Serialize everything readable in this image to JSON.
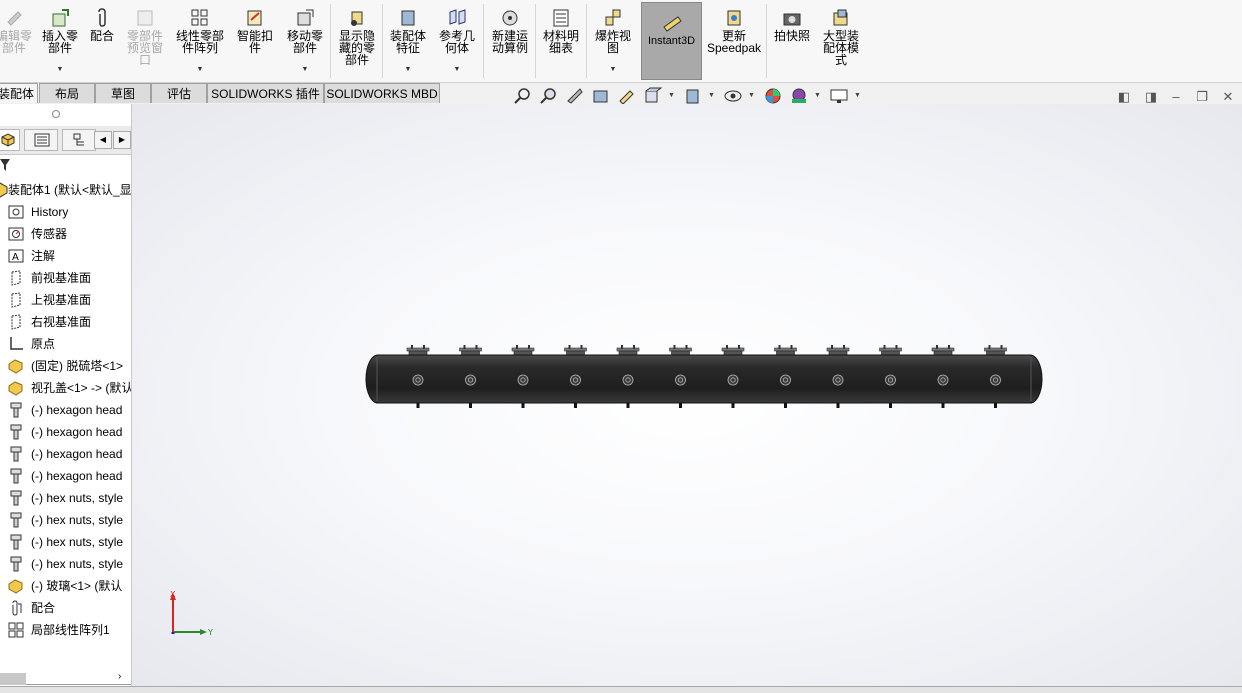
{
  "ribbon": {
    "buttons": [
      {
        "id": "edit_part",
        "label": "编辑零\n部件",
        "icon": "edit-component-icon",
        "disabled": true
      },
      {
        "id": "insert_part",
        "label": "插入零\n部件",
        "icon": "insert-component-icon"
      },
      {
        "id": "mate",
        "label": "配合",
        "icon": "mate-paperclip-icon"
      },
      {
        "id": "preview",
        "label": "零部件\n预览窗\n口",
        "icon": "component-preview-icon",
        "disabled": true
      },
      {
        "id": "linear_pattern",
        "label": "线性零部\n件阵列",
        "icon": "linear-pattern-icon"
      },
      {
        "id": "smart_fastener",
        "label": "智能扣\n件",
        "icon": "smart-fastener-icon"
      },
      {
        "id": "move_part",
        "label": "移动零\n部件",
        "icon": "move-component-icon"
      },
      {
        "id": "show_hidden",
        "label": "显示隐\n藏的零\n部件",
        "icon": "show-hidden-icon"
      },
      {
        "id": "asm_feature",
        "label": "装配体\n特征",
        "icon": "assembly-feature-icon"
      },
      {
        "id": "ref_geom",
        "label": "参考几\n何体",
        "icon": "reference-geometry-icon"
      },
      {
        "id": "motion_study",
        "label": "新建运\n动算例",
        "icon": "motion-study-icon"
      },
      {
        "id": "bom",
        "label": "材料明\n细表",
        "icon": "bill-of-materials-icon"
      },
      {
        "id": "exploded",
        "label": "爆炸视\n图",
        "icon": "exploded-view-icon"
      },
      {
        "id": "instant3d",
        "label": "Instant3D",
        "icon": "instant3d-icon",
        "active": true
      },
      {
        "id": "speedpak",
        "label": "更新\nSpeedpak",
        "icon": "speedpak-icon"
      },
      {
        "id": "snapshot",
        "label": "拍快照",
        "icon": "camera-icon"
      },
      {
        "id": "large_asm",
        "label": "大型装\n配体模\n式",
        "icon": "large-assembly-icon"
      }
    ]
  },
  "tabs": [
    "装配体",
    "布局",
    "草图",
    "评估",
    "SOLIDWORKS 插件",
    "SOLIDWORKS MBD"
  ],
  "tree": [
    {
      "label": "装配体1  (默认<默认_显",
      "icon": "assembly-icon"
    },
    {
      "label": "History",
      "icon": "history-icon"
    },
    {
      "label": "传感器",
      "icon": "sensor-icon"
    },
    {
      "label": "注解",
      "icon": "annotation-icon"
    },
    {
      "label": "前视基准面",
      "icon": "plane-icon"
    },
    {
      "label": "上视基准面",
      "icon": "plane-icon"
    },
    {
      "label": "右视基准面",
      "icon": "plane-icon"
    },
    {
      "label": "原点",
      "icon": "origin-icon"
    },
    {
      "label": "(固定) 脱硫塔<1>",
      "icon": "part-icon"
    },
    {
      "label": "视孔盖<1> -> (默认",
      "icon": "part-icon"
    },
    {
      "label": "(-) hexagon head",
      "icon": "bolt-icon"
    },
    {
      "label": "(-) hexagon head",
      "icon": "bolt-icon"
    },
    {
      "label": "(-) hexagon head",
      "icon": "bolt-icon"
    },
    {
      "label": "(-) hexagon head",
      "icon": "bolt-icon"
    },
    {
      "label": "(-) hex nuts, style",
      "icon": "bolt-icon"
    },
    {
      "label": "(-) hex nuts, style",
      "icon": "bolt-icon"
    },
    {
      "label": "(-) hex nuts, style",
      "icon": "bolt-icon"
    },
    {
      "label": "(-) hex nuts, style",
      "icon": "bolt-icon"
    },
    {
      "label": "(-) 玻璃<1> (默认",
      "icon": "part-icon"
    },
    {
      "label": "配合",
      "icon": "mates-icon"
    },
    {
      "label": "局部线性阵列1",
      "icon": "pattern-icon"
    }
  ],
  "triad": {
    "x_label": "X",
    "y_label": "Y"
  },
  "colors": {
    "accent": "#a9a9a9",
    "viewport_bg": "#ffffff",
    "model": "#2b2b2b"
  },
  "model": {
    "nozzle_count": 12
  }
}
